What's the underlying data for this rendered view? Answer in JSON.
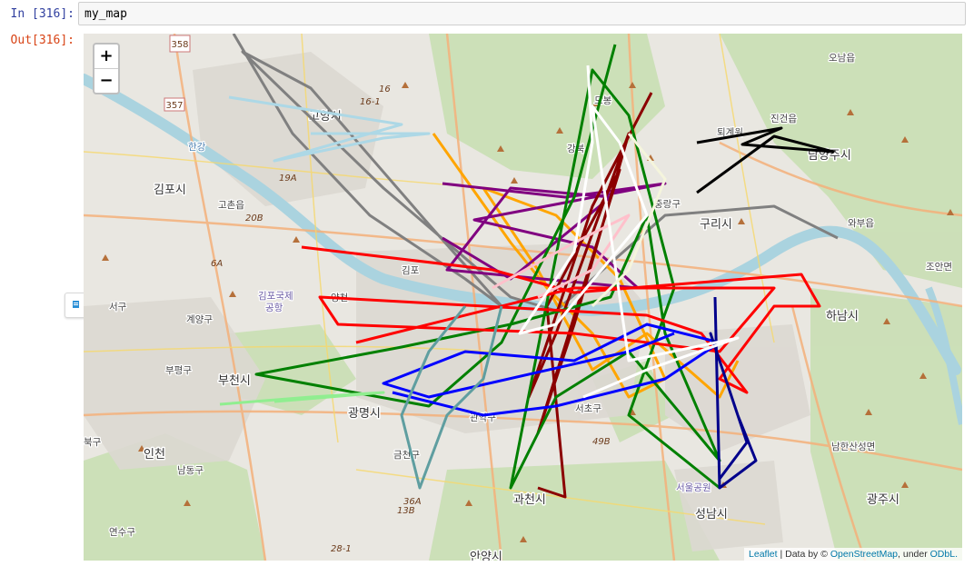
{
  "cell": {
    "in_prompt": "In [316]:",
    "out_prompt": "Out[316]:",
    "code": "my_map"
  },
  "map": {
    "zoom_in_label": "+",
    "zoom_out_label": "−",
    "attribution": {
      "leaflet": "Leaflet",
      "sep1": " | Data by © ",
      "osm": "OpenStreetMap",
      "sep2": ", under ",
      "odbl": "ODbL."
    },
    "labels": {
      "goyang": "고양시",
      "gimpo": "김포시",
      "gochon": "고촌읍",
      "airport1": "김포국제",
      "airport2": "공항",
      "seogu": "서구",
      "gyeyang": "계양구",
      "bupyeong": "부평구",
      "bucheon": "부천시",
      "incheon": "인천",
      "namdong": "남동구",
      "yeonsu": "연수구",
      "gwangmyeong": "광명시",
      "geumcheon": "금천구",
      "gwanak": "관악구",
      "seocho": "서초구",
      "gwacheon": "과천시",
      "anyang": "안양시",
      "seongnam": "성남시",
      "seoulpark": "서울공원",
      "gwangju": "광주시",
      "namhansan": "남한산성면",
      "hanam": "하남시",
      "guri": "구리시",
      "namyangju": "남양주시",
      "jingeon": "진건읍",
      "twigyewon": "퇴계원",
      "onam": "오남읍",
      "wabu": "와부읍",
      "joan": "조안면",
      "jungnang": "중랑구",
      "gangbuk": "강북",
      "gimpo_gu": "김포",
      "yangcheon": "양천",
      "hangang": "한강",
      "dobong": "도봉",
      "bukgu": "북구"
    },
    "routes": [
      "357",
      "358",
      "16-1",
      "16",
      "19A",
      "20B",
      "6A",
      "49B",
      "36A",
      "13B",
      "28-1"
    ],
    "colors": {
      "black": "#000000",
      "gray": "#808080",
      "lightblue": "#add8e6",
      "orange": "#ffa500",
      "purple": "#800080",
      "darkred": "#8b0000",
      "green": "#008000",
      "red": "#ff0000",
      "blue": "#0000ff",
      "darkblue": "#00008b",
      "cadetblue": "#5f9ea0",
      "lightgreen": "#90ee90",
      "pink": "#ffc0cb",
      "white": "#ffffff",
      "beige": "#f5f5dc"
    }
  }
}
